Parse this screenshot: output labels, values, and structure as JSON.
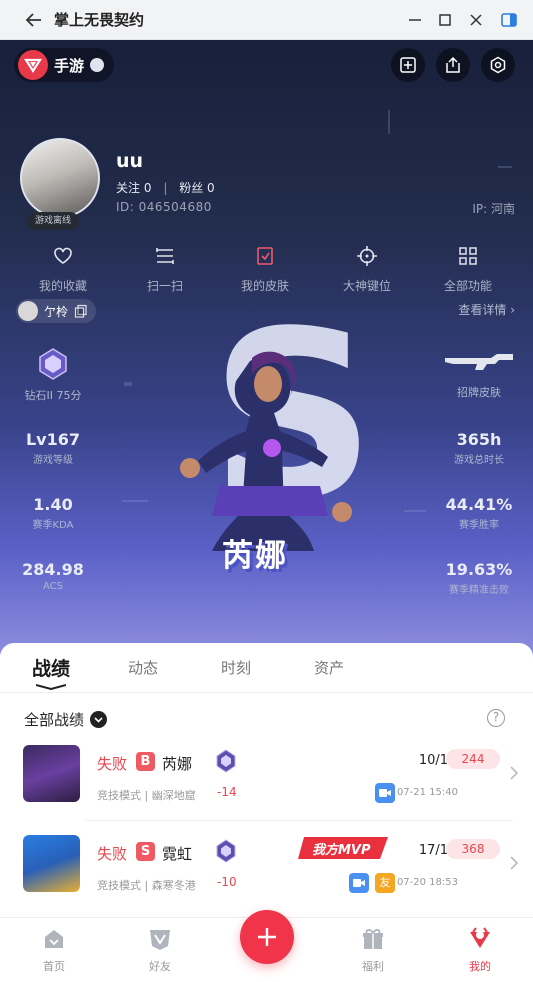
{
  "window": {
    "title": "掌上无畏契约",
    "controls": [
      "back-icon",
      "minimize-icon",
      "maximize-icon",
      "close-icon",
      "sidebar-icon"
    ]
  },
  "hero": {
    "app_switch_label": "手游",
    "top_buttons": [
      "add-post-icon",
      "share-icon",
      "settings-icon"
    ],
    "profile": {
      "username": "uu",
      "follow_label": "关注",
      "follow_count": "0",
      "fans_label": "粉丝",
      "fans_count": "0",
      "id_text": "ID:  046504680",
      "ip_text": "IP:  河南",
      "status_tag": "游戏离线"
    },
    "shortcuts": [
      {
        "label": "我的收藏",
        "icon": "heart-icon"
      },
      {
        "label": "扫一扫",
        "icon": "scan-icon"
      },
      {
        "label": "我的皮肤",
        "icon": "skin-icon"
      },
      {
        "label": "大神键位",
        "icon": "crosshair-icon"
      },
      {
        "label": "全部功能",
        "icon": "grid-icon"
      }
    ],
    "account_chip": "亇柃",
    "detail_link": "查看详情 ›",
    "rank": {
      "label": "钻石II 75分"
    },
    "skin_label": "招牌皮肤",
    "stats_left": [
      {
        "value": "Lv167",
        "label": "游戏等级"
      },
      {
        "value": "1.40",
        "label": "赛季KDA"
      },
      {
        "value": "284.98",
        "label": "ACS"
      }
    ],
    "stats_right": [
      {
        "value": "365h",
        "label": "游戏总时长"
      },
      {
        "value": "44.41%",
        "label": "赛季胜率"
      },
      {
        "value": "19.63%",
        "label": "赛季精准击败"
      }
    ],
    "letter": "S",
    "agent_name": "芮娜"
  },
  "panel": {
    "tabs": [
      "战绩",
      "动态",
      "时刻",
      "资产"
    ],
    "active_tab": "战绩",
    "filter_label": "全部战绩",
    "help_symbol": "?",
    "matches": [
      {
        "result": "失败",
        "letter": "B",
        "agent": "芮娜",
        "mode": "竞技模式 | 幽深地窟",
        "delta": "-14",
        "kda": "10/10/3",
        "score": "244",
        "time": "07-21 15:40",
        "tags": [
          {
            "type": "video",
            "text": ""
          }
        ],
        "mvp": ""
      },
      {
        "result": "失败",
        "letter": "S",
        "agent": "霓虹",
        "mode": "竞技模式 | 森寒冬港",
        "delta": "-10",
        "kda": "17/13/4",
        "score": "368",
        "time": "07-20 18:53",
        "tags": [
          {
            "type": "video",
            "text": ""
          },
          {
            "type": "friend",
            "text": "友"
          }
        ],
        "mvp": "我方MVP"
      }
    ]
  },
  "bottom_nav": [
    {
      "label": "首页",
      "icon": "home-icon"
    },
    {
      "label": "好友",
      "icon": "friends-icon"
    },
    {
      "label": "",
      "icon": "plus-icon"
    },
    {
      "label": "福利",
      "icon": "gift-icon"
    },
    {
      "label": "我的",
      "icon": "profile-icon"
    }
  ],
  "colors": {
    "accent": "#e8394a",
    "loss": "#e8474f",
    "video_tag": "#4a90f0",
    "friend_tag": "#f5a623"
  }
}
